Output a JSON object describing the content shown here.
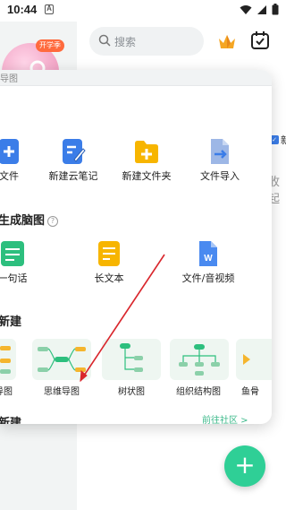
{
  "status_bar": {
    "time": "10:44",
    "notif_badge": "A"
  },
  "background": {
    "avatar_badge": "开学季",
    "search_placeholder": "搜索",
    "right_chip_text": "新",
    "right_text": "收起"
  },
  "sheet": {
    "top_strip_text": "导图",
    "create_items": [
      {
        "label": "文件"
      },
      {
        "label": "新建云笔记"
      },
      {
        "label": "新建文件夹"
      },
      {
        "label": "文件导入"
      }
    ],
    "ai_section_title": "生成脑图",
    "ai_items": [
      {
        "label": "一句话"
      },
      {
        "label": "长文本"
      },
      {
        "label": "文件/音视频"
      }
    ],
    "new_section_title": "新建",
    "templates": [
      {
        "label": "导图"
      },
      {
        "label": "思维导图"
      },
      {
        "label": "树状图"
      },
      {
        "label": "组织结构图"
      },
      {
        "label": "鱼骨"
      }
    ],
    "bottom_section_title": "新建",
    "community_link": "前往社区 >"
  },
  "colors": {
    "accent": "#2fcf96",
    "annotation_arrow": "#d9262c"
  }
}
